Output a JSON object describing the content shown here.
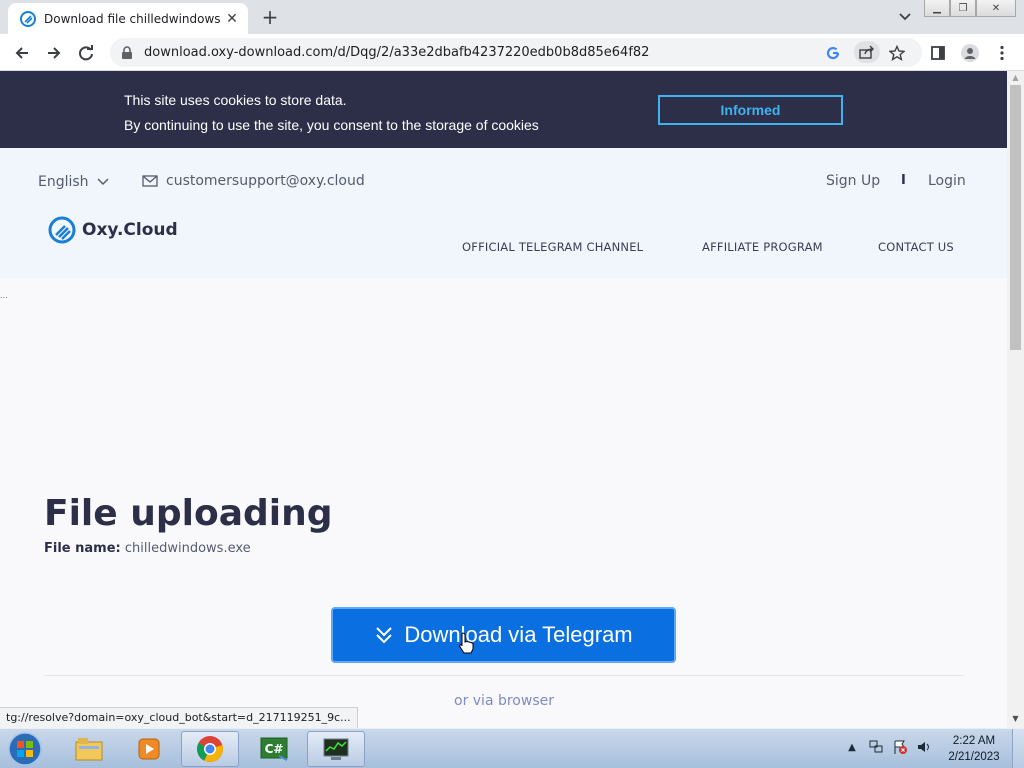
{
  "browser": {
    "tab_title": "Download file chilledwindows.exe",
    "url": "download.oxy-download.com/d/Dqg/2/a33e2dbafb4237220edb0b8d85e64f82",
    "status_url": "tg://resolve?domain=oxy_cloud_bot&start=d_217119251_9c..."
  },
  "cookie_banner": {
    "line1": "This site uses cookies to store data.",
    "line2": "By continuing to use the site, you consent to the storage of cookies",
    "button": "Informed"
  },
  "header": {
    "language": "English",
    "email": "customersupport@oxy.cloud",
    "signup": "Sign Up",
    "separator": "I",
    "login": "Login",
    "logo_text": "Oxy.Cloud",
    "nav": [
      "OFFICIAL TELEGRAM CHANNEL",
      "AFFILIATE PROGRAM",
      "CONTACT US"
    ]
  },
  "main": {
    "title": "File uploading",
    "file_label": "File name:",
    "file_name": "chilledwindows.exe",
    "download_button": "Download via Telegram",
    "alt_link": "or via browser",
    "side_dots": "..."
  },
  "taskbar": {
    "time": "2:22 AM",
    "date": "2/21/2023",
    "apps": [
      "windows-explorer",
      "media-player",
      "chrome",
      "csharp-app",
      "task-manager"
    ]
  },
  "colors": {
    "accent": "#0a6fe0",
    "banner": "#2d2f48",
    "cookie_button": "#3fb2f0"
  }
}
